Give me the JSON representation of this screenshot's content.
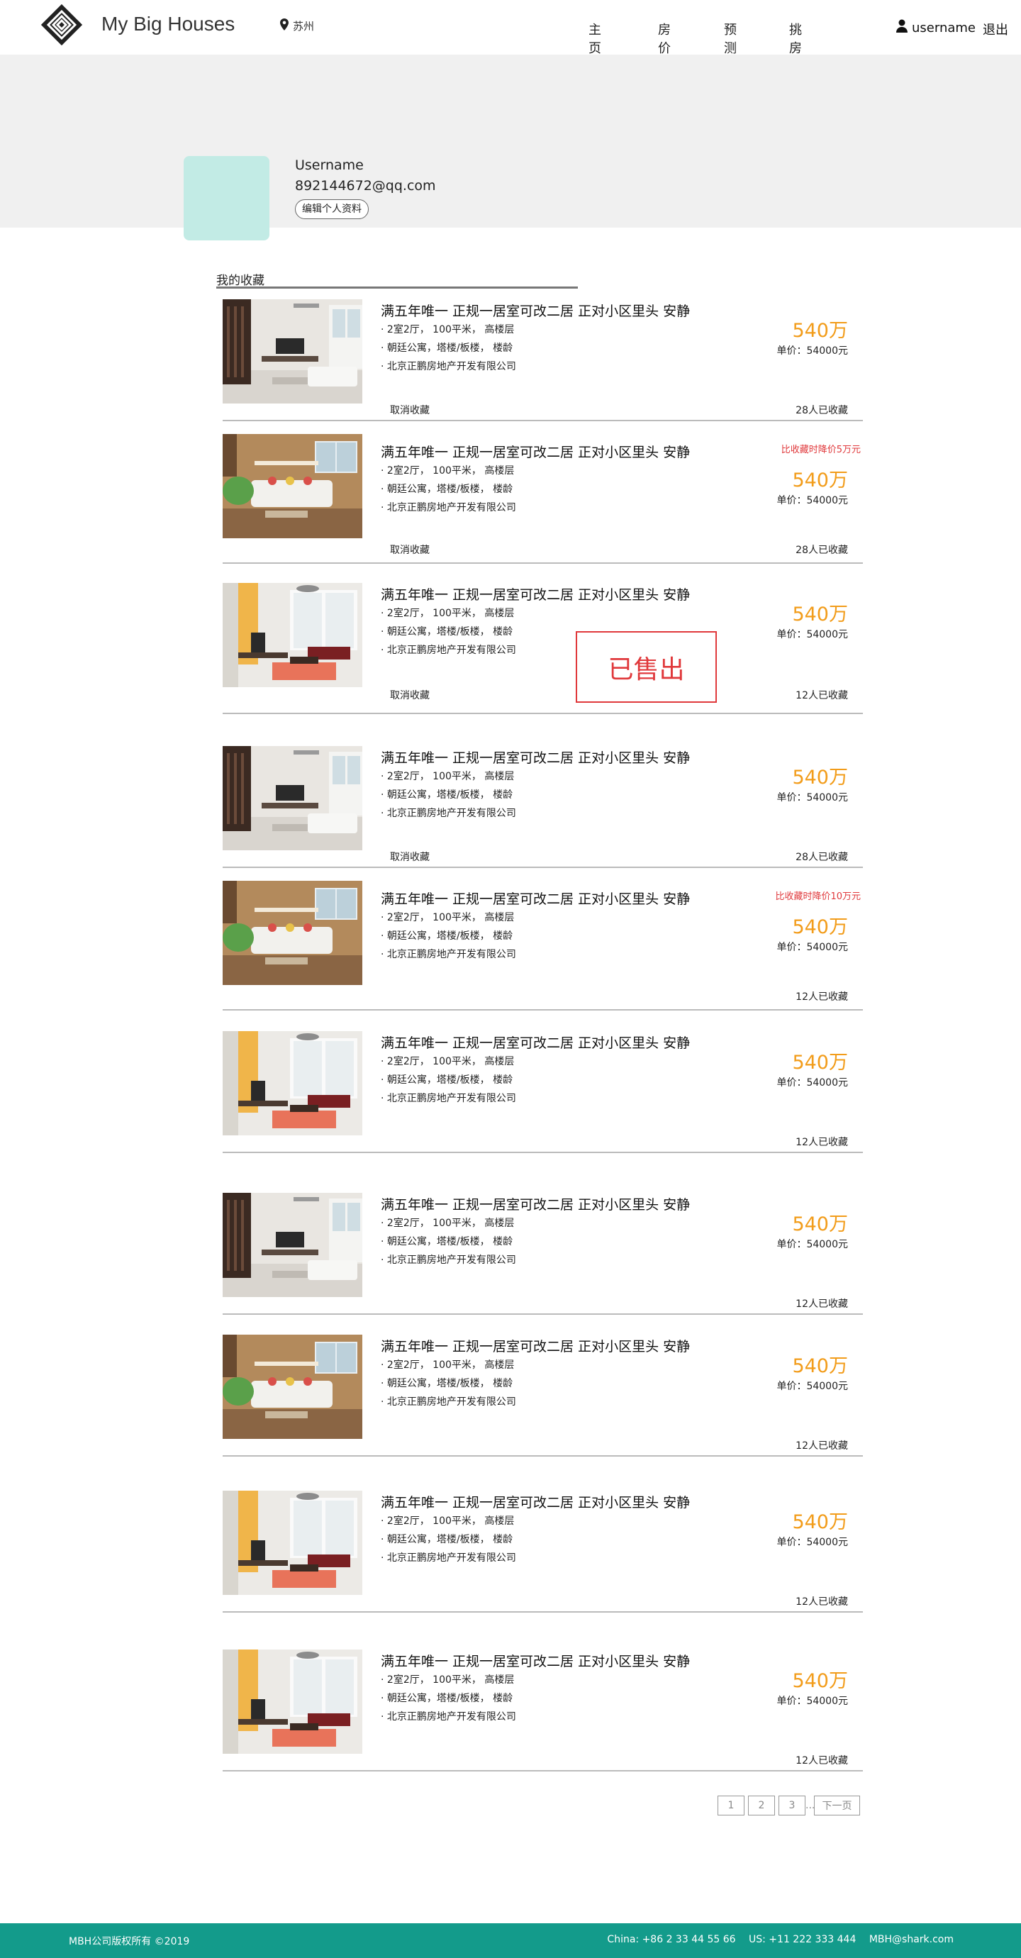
{
  "header": {
    "brand": "My Big Houses",
    "city": "苏州",
    "nav": [
      "主页",
      "房价",
      "预测",
      "挑房"
    ],
    "username": "username",
    "logout": "退出"
  },
  "profile": {
    "name": "Username",
    "email": "892144672@qq.com",
    "edit_label": "编辑个人资料"
  },
  "section": {
    "title": "我的收藏"
  },
  "listings": [
    {
      "title": "满五年唯一  正规一居室可改二居 正对小区里头 安静",
      "layout": "2室2厅，  100平米，  高楼层",
      "type": "朝廷公寓，塔楼/板楼，  楼龄",
      "agency": "北京正鹏房地产开发有限公司",
      "cancel": "取消收藏",
      "drop": "",
      "price": "540万",
      "unit_price": "单价：54000元",
      "favs": "28人已收藏",
      "sold": "",
      "photo": "a"
    },
    {
      "title": "满五年唯一  正规一居室可改二居 正对小区里头 安静",
      "layout": "2室2厅，  100平米，  高楼层",
      "type": "朝廷公寓，塔楼/板楼，  楼龄",
      "agency": "北京正鹏房地产开发有限公司",
      "cancel": "取消收藏",
      "drop": "比收藏时降价5万元",
      "price": "540万",
      "unit_price": "单价：54000元",
      "favs": "28人已收藏",
      "sold": "",
      "photo": "b"
    },
    {
      "title": "满五年唯一  正规一居室可改二居 正对小区里头 安静",
      "layout": "2室2厅，  100平米，  高楼层",
      "type": "朝廷公寓，塔楼/板楼，  楼龄",
      "agency": "北京正鹏房地产开发有限公司",
      "cancel": "取消收藏",
      "drop": "",
      "price": "540万",
      "unit_price": "单价：54000元",
      "favs": "12人已收藏",
      "sold": "已售出",
      "photo": "c"
    },
    {
      "title": "满五年唯一  正规一居室可改二居 正对小区里头 安静",
      "layout": "2室2厅，  100平米，  高楼层",
      "type": "朝廷公寓，塔楼/板楼，  楼龄",
      "agency": "北京正鹏房地产开发有限公司",
      "cancel": "取消收藏",
      "drop": "",
      "price": "540万",
      "unit_price": "单价：54000元",
      "favs": "28人已收藏",
      "sold": "",
      "photo": "a"
    },
    {
      "title": "满五年唯一  正规一居室可改二居 正对小区里头 安静",
      "layout": "2室2厅，  100平米，  高楼层",
      "type": "朝廷公寓，塔楼/板楼，  楼龄",
      "agency": "北京正鹏房地产开发有限公司",
      "cancel": "",
      "drop": "比收藏时降价10万元",
      "price": "540万",
      "unit_price": "单价：54000元",
      "favs": "12人已收藏",
      "sold": "",
      "photo": "b"
    },
    {
      "title": "满五年唯一  正规一居室可改二居 正对小区里头 安静",
      "layout": "2室2厅，  100平米，  高楼层",
      "type": "朝廷公寓，塔楼/板楼，  楼龄",
      "agency": "北京正鹏房地产开发有限公司",
      "cancel": "",
      "drop": "",
      "price": "540万",
      "unit_price": "单价：54000元",
      "favs": "12人已收藏",
      "sold": "",
      "photo": "c"
    },
    {
      "title": "满五年唯一  正规一居室可改二居 正对小区里头 安静",
      "layout": "2室2厅，  100平米，  高楼层",
      "type": "朝廷公寓，塔楼/板楼，  楼龄",
      "agency": "北京正鹏房地产开发有限公司",
      "cancel": "",
      "drop": "",
      "price": "540万",
      "unit_price": "单价：54000元",
      "favs": "12人已收藏",
      "sold": "",
      "photo": "a"
    },
    {
      "title": "满五年唯一  正规一居室可改二居 正对小区里头 安静",
      "layout": "2室2厅，  100平米，  高楼层",
      "type": "朝廷公寓，塔楼/板楼，  楼龄",
      "agency": "北京正鹏房地产开发有限公司",
      "cancel": "",
      "drop": "",
      "price": "540万",
      "unit_price": "单价：54000元",
      "favs": "12人已收藏",
      "sold": "",
      "photo": "b"
    },
    {
      "title": "满五年唯一  正规一居室可改二居 正对小区里头 安静",
      "layout": "2室2厅，  100平米，  高楼层",
      "type": "朝廷公寓，塔楼/板楼，  楼龄",
      "agency": "北京正鹏房地产开发有限公司",
      "cancel": "",
      "drop": "",
      "price": "540万",
      "unit_price": "单价：54000元",
      "favs": "12人已收藏",
      "sold": "",
      "photo": "c"
    },
    {
      "title": "满五年唯一  正规一居室可改二居 正对小区里头 安静",
      "layout": "2室2厅，  100平米，  高楼层",
      "type": "朝廷公寓，塔楼/板楼，  楼龄",
      "agency": "北京正鹏房地产开发有限公司",
      "cancel": "",
      "drop": "",
      "price": "540万",
      "unit_price": "单价：54000元",
      "favs": "12人已收藏",
      "sold": "",
      "photo": "c"
    }
  ],
  "pagination": {
    "pages": [
      "1",
      "2",
      "3"
    ],
    "ellipsis": "...",
    "next": "下一页"
  },
  "footer": {
    "copyright": "MBH公司版权所有 ©2019",
    "china": "China: +86 2 33 44 55 66",
    "us": "US: +11 222 333 444",
    "email": "MBH@shark.com"
  },
  "colors": {
    "accent_price": "#f29c1a",
    "alert_red": "#e0383b",
    "footer_teal": "#139b8b",
    "avatar_mint": "#c2ebe5"
  },
  "icons": [
    "logo-diamond-icon",
    "location-pin-icon",
    "user-icon"
  ]
}
